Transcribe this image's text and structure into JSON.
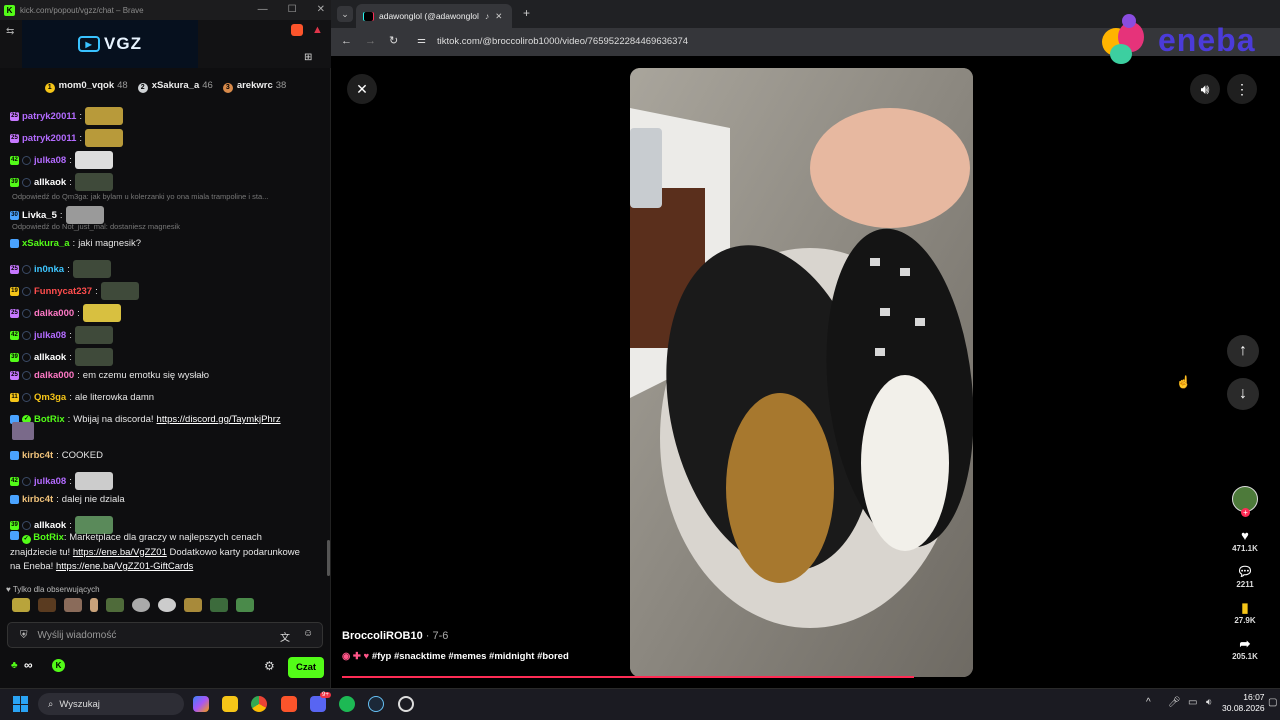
{
  "kick_window": {
    "title": "kick.com/popout/vgzz/chat – Brave",
    "logo_text": "VGZ",
    "leaders": [
      {
        "name": "mom0_vqok",
        "count": "48",
        "color": "#f5c518",
        "rank": "1"
      },
      {
        "name": "xSakura_a",
        "count": "46",
        "color": "#cfd3d6",
        "rank": "2"
      },
      {
        "name": "arekwrc",
        "count": "38",
        "color": "#d88a4a",
        "rank": "3"
      }
    ],
    "messages": [
      {
        "user": "patryk20011",
        "color": "#b36bff",
        "text": "",
        "badge": "25",
        "badge_color": "#c678ff"
      },
      {
        "user": "patryk20011",
        "color": "#b36bff",
        "text": "",
        "badge": "25",
        "badge_color": "#c678ff"
      },
      {
        "user": "julka08",
        "color": "#b36bff",
        "text": "",
        "badge": "42",
        "badge_color": "#53fc18"
      },
      {
        "user": "allkaok",
        "color": "#ffffff",
        "text": "",
        "badge": "39",
        "badge_color": "#53fc18"
      },
      {
        "user": "Livka_5",
        "color": "#ffffff",
        "text": "",
        "badge": "30",
        "badge_color": "#4aa3ff"
      },
      {
        "user": "xSakura_a",
        "color": "#53fc18",
        "text": "jaki magnesik?",
        "badge": "",
        "badge_color": "#4aa3ff"
      },
      {
        "user": "in0nka",
        "color": "#3ec6ff",
        "text": "",
        "badge": "25",
        "badge_color": "#c678ff"
      },
      {
        "user": "Funnycat237",
        "color": "#ff4d4d",
        "text": "",
        "badge": "19",
        "badge_color": "#f5c518"
      },
      {
        "user": "dalka000",
        "color": "#ff79c6",
        "text": "",
        "badge": "25",
        "badge_color": "#c678ff"
      },
      {
        "user": "julka08",
        "color": "#b36bff",
        "text": "",
        "badge": "42",
        "badge_color": "#53fc18"
      },
      {
        "user": "allkaok",
        "color": "#ffffff",
        "text": "",
        "badge": "39",
        "badge_color": "#53fc18"
      },
      {
        "user": "dalka000",
        "color": "#ff79c6",
        "text": "em czemu emotku się wysłało",
        "badge": "25",
        "badge_color": "#c678ff"
      },
      {
        "user": "Qm3ga",
        "color": "#f5c518",
        "text": "ale literowka damn",
        "badge": "11",
        "badge_color": "#f5c518"
      },
      {
        "user": "BotRix",
        "color": "#53fc18",
        "text": "Wbijaj na discorda!",
        "link": "https://discord.gg/TaymkjPhrz",
        "badge": "",
        "badge_color": "#4aa3ff"
      },
      {
        "user": "kirbc4t",
        "color": "#f0c27a",
        "text": "COOKED",
        "badge": "",
        "badge_color": "#4aa3ff"
      },
      {
        "user": "julka08",
        "color": "#b36bff",
        "text": "",
        "badge": "42",
        "badge_color": "#53fc18"
      },
      {
        "user": "kirbc4t",
        "color": "#f0c27a",
        "text": "dalej nie dziala",
        "badge": "",
        "badge_color": "#4aa3ff"
      },
      {
        "user": "allkaok",
        "color": "#ffffff",
        "text": "",
        "badge": "39",
        "badge_color": "#53fc18"
      }
    ],
    "replies": [
      "Odpowiedź do Qm3ga: jak bylam u kolerzanki yo ona miala trampoline i sta...",
      "Odpowiedź do Not_just_mal: dostaniesz magnesik"
    ],
    "botrix_ad": {
      "line1": "Marketplace dla graczy w najlepszych cenach",
      "line2a": "znajdziecie tu!",
      "link1": "https://ene.ba/VgZZ01",
      "line2b": "Dodatkowo karty podarunkowe",
      "line3a": "na Eneba!",
      "link2": "https://ene.ba/VgZZ01-GiftCards"
    },
    "followers_only": "Tylko dla obserwujących",
    "input_placeholder": "Wyślij wiadomość",
    "infinity": "∞",
    "send_button": "Czat"
  },
  "browser": {
    "tab_title": "adawonglol (@adawonglol)",
    "url": "tiktok.com/@broccolirob1000/video/7659522284469636374",
    "caption_user": "BroccoliROB10",
    "caption_date": " · 7-6",
    "caption_tags": "#fyp #snacktime #memes #midnight #bored",
    "likes": "471.1K",
    "comments": "2211",
    "saves": "27.9K",
    "shares": "205.1K",
    "progress": 0.96
  },
  "eneba": {
    "text": "eneba"
  },
  "taskbar": {
    "search": "Wyszukaj",
    "time": "16:07",
    "date": "30.08.2026",
    "discord_badge": "9+"
  }
}
